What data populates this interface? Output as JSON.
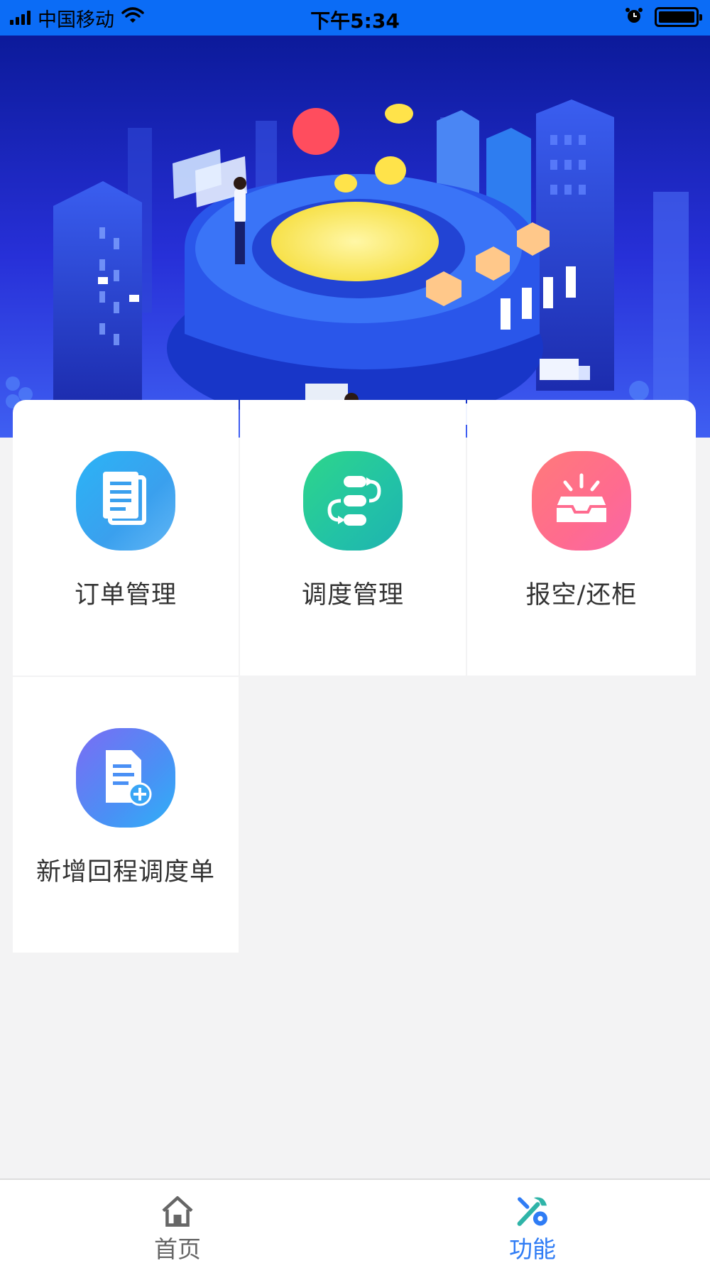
{
  "status_bar": {
    "carrier": "中国移动",
    "time": "下午5:34"
  },
  "functions": [
    {
      "label": "订单管理",
      "icon": "document-icon",
      "color": "#2bb4f6"
    },
    {
      "label": "调度管理",
      "icon": "flow-icon",
      "color": "#22c2a6"
    },
    {
      "label": "报空/还柜",
      "icon": "inbox-icon",
      "color": "#ff6b8f"
    },
    {
      "label": "新增回程调度单",
      "icon": "add-document-icon",
      "color": "#4a90f5"
    }
  ],
  "tab_bar": {
    "tabs": [
      {
        "label": "首页",
        "icon": "home-icon",
        "active": false
      },
      {
        "label": "功能",
        "icon": "tools-icon",
        "active": true
      }
    ],
    "active_color": "#2f7cf5"
  }
}
